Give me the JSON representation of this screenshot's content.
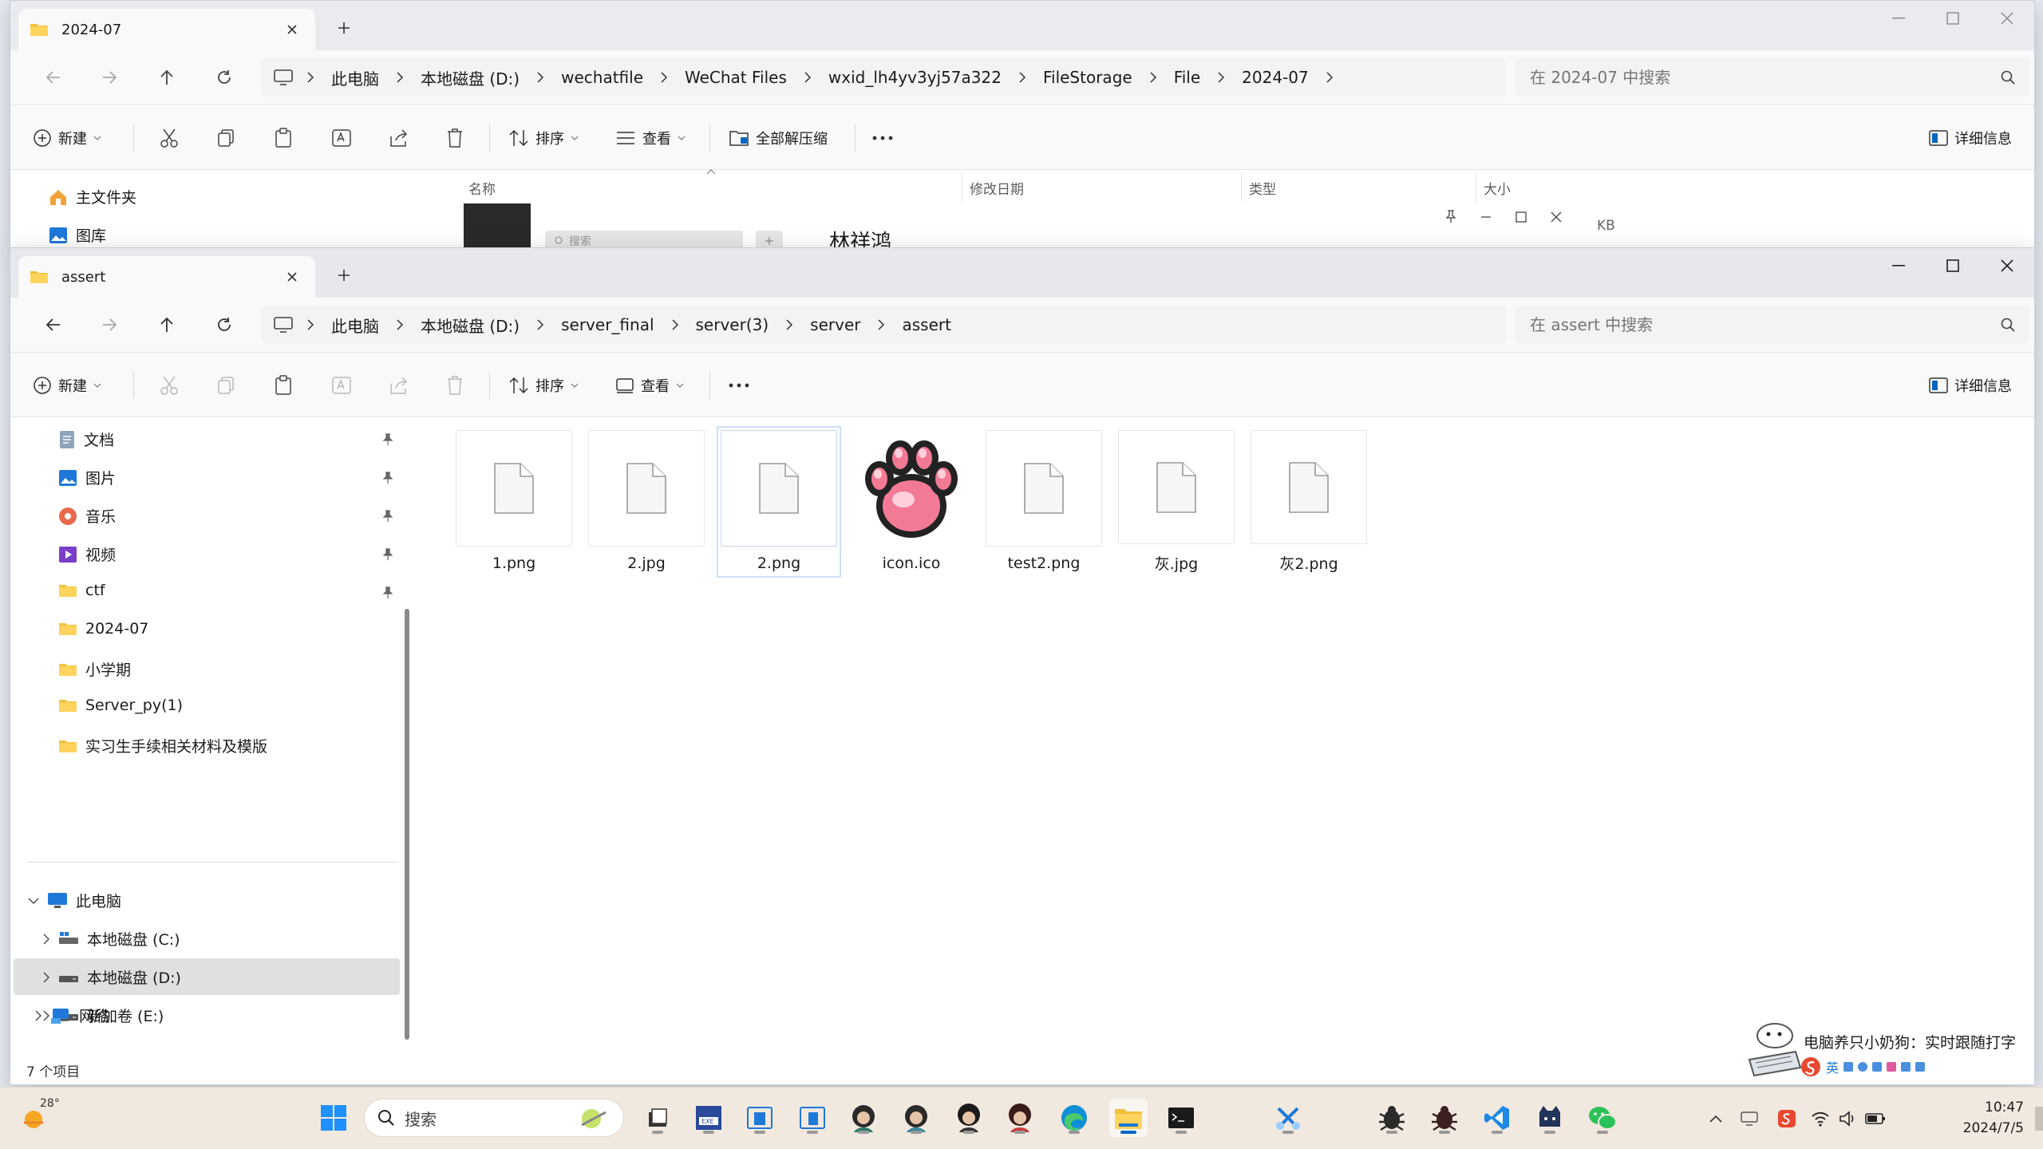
{
  "back_window": {
    "tab_title": "2024-07",
    "breadcrumb": [
      "此电脑",
      "本地磁盘 (D:)",
      "wechatfile",
      "WeChat Files",
      "wxid_lh4yv3yj57a322",
      "FileStorage",
      "File",
      "2024-07"
    ],
    "search_placeholder": "在 2024-07 中搜索",
    "toolbar": {
      "new": "新建",
      "sort": "排序",
      "view": "查看",
      "extract_all": "全部解压缩",
      "details": "详细信息"
    },
    "nav": [
      "主文件夹",
      "图库"
    ],
    "columns": [
      "名称",
      "修改日期",
      "类型",
      "大小"
    ],
    "preview_name": "林祥鸿",
    "preview_search": "搜索",
    "size_fragment": "KB"
  },
  "front_window": {
    "tab_title": "assert",
    "breadcrumb": [
      "此电脑",
      "本地磁盘 (D:)",
      "server_final",
      "server(3)",
      "server",
      "assert"
    ],
    "search_placeholder": "在 assert 中搜索",
    "toolbar": {
      "new": "新建",
      "sort": "排序",
      "view": "查看",
      "details": "详细信息"
    },
    "quick_access": [
      {
        "label": "文档",
        "icon": "documents-icon",
        "pinned": true
      },
      {
        "label": "图片",
        "icon": "pictures-icon",
        "pinned": true
      },
      {
        "label": "音乐",
        "icon": "music-icon",
        "pinned": true
      },
      {
        "label": "视频",
        "icon": "videos-icon",
        "pinned": true
      },
      {
        "label": "ctf",
        "icon": "folder-icon",
        "pinned": true
      },
      {
        "label": "2024-07",
        "icon": "folder-icon",
        "pinned": false
      },
      {
        "label": "小学期",
        "icon": "folder-icon",
        "pinned": false
      },
      {
        "label": "Server_py(1)",
        "icon": "folder-icon",
        "pinned": false
      },
      {
        "label": "实习生手续相关材料及模版",
        "icon": "folder-icon",
        "pinned": false
      }
    ],
    "this_pc": {
      "label": "此电脑",
      "drives": [
        {
          "label": "本地磁盘 (C:)",
          "selected": false
        },
        {
          "label": "本地磁盘 (D:)",
          "selected": true
        },
        {
          "label": "新加卷 (E:)",
          "selected": false
        }
      ]
    },
    "network": "网络",
    "files": [
      {
        "name": "1.png",
        "kind": "generic",
        "selected": false
      },
      {
        "name": "2.jpg",
        "kind": "generic",
        "selected": false
      },
      {
        "name": "2.png",
        "kind": "generic",
        "selected": true
      },
      {
        "name": "icon.ico",
        "kind": "paw",
        "selected": false
      },
      {
        "name": "test2.png",
        "kind": "generic",
        "selected": false
      },
      {
        "name": "灰.jpg",
        "kind": "generic",
        "selected": false
      },
      {
        "name": "灰2.png",
        "kind": "generic",
        "selected": false
      }
    ],
    "status": "7 个项目"
  },
  "ime_popup": {
    "text": "电脑养只小奶狗：实时跟随打字",
    "mode": "英"
  },
  "taskbar": {
    "weather_temp": "28°",
    "search_placeholder": "搜索",
    "time": "10:47",
    "date": "2024/7/5"
  },
  "colors": {
    "accent": "#0067c0",
    "folder": "#f3c13a",
    "paw_pink": "#f06a8a",
    "taskbar_bg": "#f1e8df"
  }
}
